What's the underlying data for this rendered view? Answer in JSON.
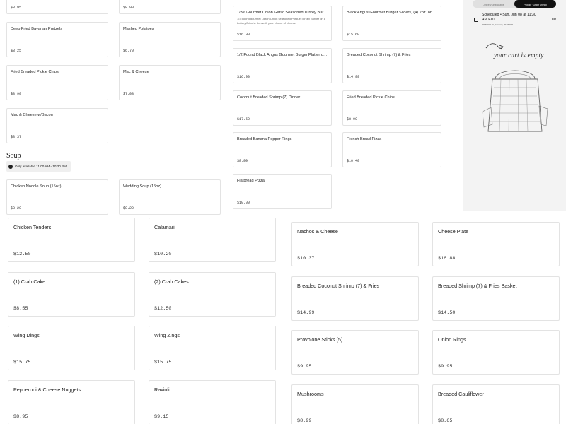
{
  "menu_top": [
    {
      "name": "",
      "price": "$8.95"
    },
    {
      "name": "",
      "price": "$8.90"
    },
    {
      "name": "Deep Fried Bavarian Pretzels",
      "price": "$8.25"
    },
    {
      "name": "Mashed Potatoes",
      "price": "$6.70"
    },
    {
      "name": "Fried Breaded Pickle Chips",
      "price": "$8.90"
    },
    {
      "name": "Mac & Cheese",
      "price": "$7.03"
    },
    {
      "name": "Mac & Cheese w/Bacon",
      "price": "$8.37"
    },
    {
      "name": "1/3# Gourmet Onion Garlic Seasoned Turkey Burger Sliders",
      "desc": "1/3 pound gourmet Lipton Onion seasoned Purdue Turkey Burger on a buttery Brioche bun with your choice of cheese,",
      "price": "$16.90"
    },
    {
      "name": "Black Angus Gourmet Burger Sliders, (4) 2oz. on Brioche",
      "price": "$15.60"
    },
    {
      "name": "1/2 Pound Black Angus Gourmet Burger Platter on Brioche",
      "price": "$16.90"
    },
    {
      "name": "Breaded Coconut Shrimp (7) & Fries",
      "price": "$14.99"
    },
    {
      "name": "Coconut Breaded Shrimp (7) Dinner",
      "price": "$17.50"
    },
    {
      "name": "Fried Breaded Pickle Chips",
      "price": "$8.90"
    },
    {
      "name": "Breaded Banana Pepper Rings",
      "price": "$8.99"
    },
    {
      "name": "French Bread Pizza",
      "price": "$10.40"
    },
    {
      "name": "Flatbread Pizza",
      "price": "$10.00"
    }
  ],
  "soup_section": {
    "title": "Soup",
    "availability": "Only available 11:00 AM - 10:30 PM",
    "items": [
      {
        "name": "Chicken Noodle Soup (15oz)",
        "price": "$8.20"
      },
      {
        "name": "Wedding Soup (15oz)",
        "price": "$8.20"
      }
    ]
  },
  "menu_bottom": [
    {
      "name": "Chicken Tenders",
      "price": "$12.50"
    },
    {
      "name": "Calamari",
      "price": "$10.20"
    },
    {
      "name": "Nachos & Cheese",
      "price": "$10.37"
    },
    {
      "name": "Cheese Plate",
      "price": "$16.88"
    },
    {
      "name": "(1) Crab Cake",
      "price": "$8.55"
    },
    {
      "name": "(2) Crab Cakes",
      "price": "$12.50"
    },
    {
      "name": "Breaded Coconut Shrimp (7) & Fries",
      "price": "$14.99"
    },
    {
      "name": "Breaded Shrimp (7) & Fries Basket",
      "price": "$14.50"
    },
    {
      "name": "Wing Dings",
      "price": "$15.75"
    },
    {
      "name": "Wing Zings",
      "price": "$15.75"
    },
    {
      "name": "Provolone Sticks (5)",
      "price": "$9.95"
    },
    {
      "name": "Onion Rings",
      "price": "$9.95"
    },
    {
      "name": "Pepperoni & Cheese Nuggets",
      "price": "$8.95"
    },
    {
      "name": "Ravioli",
      "price": "$9.15"
    },
    {
      "name": "Mushrooms",
      "price": "$8.99"
    },
    {
      "name": "Breaded Cauliflower",
      "price": "$8.65"
    }
  ],
  "cart": {
    "toggle_left": "Delivery unavailable",
    "toggle_right": "Pickup · Order ahead",
    "schedule_text": "Scheduled • Sun, Jun 08 at 11:30 AM EDT",
    "address": "1098 10th St, Conway, PA 15027",
    "edit_label": "Edit",
    "empty_message": "your cart is empty",
    "icon": "shopping-bag-illustration"
  }
}
